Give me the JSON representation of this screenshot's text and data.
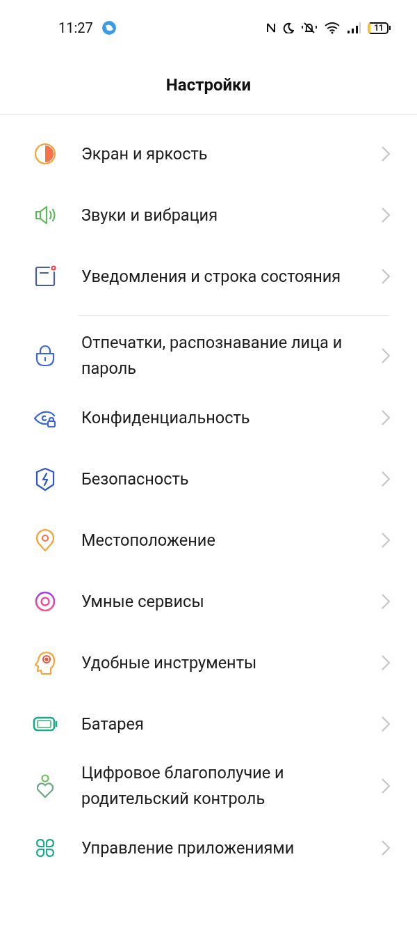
{
  "status_bar": {
    "time": "11:27",
    "battery_text": "11"
  },
  "title": "Настройки",
  "sections": [
    {
      "items": [
        {
          "kind": "display",
          "label": "Экран и яркость"
        },
        {
          "kind": "sound",
          "label": "Звуки и вибрация"
        },
        {
          "kind": "notifications",
          "label": "Уведомления и строка состояния"
        }
      ]
    },
    {
      "items": [
        {
          "kind": "lock",
          "label": "Отпечатки, распознавание лица и пароль"
        },
        {
          "kind": "privacy",
          "label": "Конфиденциальность"
        },
        {
          "kind": "security",
          "label": "Безопасность"
        },
        {
          "kind": "location",
          "label": "Местоположение"
        },
        {
          "kind": "smart",
          "label": "Умные сервисы"
        },
        {
          "kind": "tools",
          "label": "Удобные инструменты"
        },
        {
          "kind": "battery",
          "label": "Батарея"
        },
        {
          "kind": "wellbeing",
          "label": "Цифровое благополучие и родительский контроль"
        },
        {
          "kind": "apps",
          "label": "Управление приложениями"
        }
      ]
    }
  ]
}
